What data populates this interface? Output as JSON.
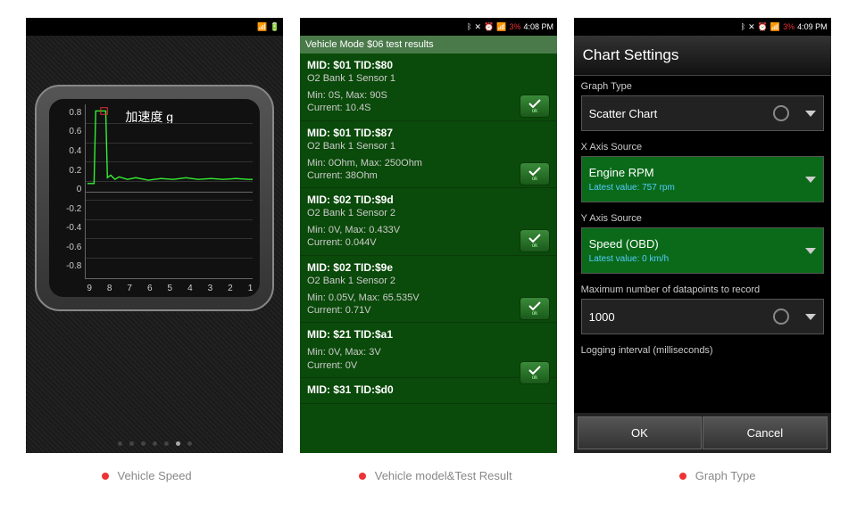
{
  "phone1": {
    "status_time": "",
    "chart_title": "加速度 g",
    "y_ticks": [
      "0.8",
      "0.6",
      "0.4",
      "0.2",
      "0",
      "-0.2",
      "-0.4",
      "-0.6",
      "-0.8"
    ],
    "x_ticks": [
      "9",
      "8",
      "7",
      "6",
      "5",
      "4",
      "3",
      "2",
      "1"
    ],
    "caption": "Vehicle Speed"
  },
  "phone2": {
    "status_time": "4:08 PM",
    "battery": "3%",
    "title": "Vehicle Mode $06 test results",
    "items": [
      {
        "mid": "MID: $01 TID:$80",
        "sensor": "O2 Bank 1 Sensor 1",
        "min": "Min: 0S, Max: 90S",
        "cur": "Current: 10.4S"
      },
      {
        "mid": "MID: $01 TID:$87",
        "sensor": "O2 Bank 1 Sensor 1",
        "min": "Min: 0Ohm, Max: 250Ohm",
        "cur": "Current: 38Ohm"
      },
      {
        "mid": "MID: $02 TID:$9d",
        "sensor": "O2 Bank 1 Sensor 2",
        "min": "Min: 0V, Max: 0.433V",
        "cur": "Current: 0.044V"
      },
      {
        "mid": "MID: $02 TID:$9e",
        "sensor": "O2 Bank 1 Sensor 2",
        "min": "Min: 0.05V, Max: 65.535V",
        "cur": "Current: 0.71V"
      },
      {
        "mid": "MID: $21 TID:$a1",
        "sensor": "",
        "min": "Min: 0V, Max: 3V",
        "cur": "Current: 0V"
      },
      {
        "mid": "MID: $31 TID:$d0",
        "sensor": "",
        "min": "",
        "cur": ""
      }
    ],
    "ok_label": "ok",
    "caption": "Vehicle model&Test Result"
  },
  "phone3": {
    "status_time": "4:09 PM",
    "battery": "3%",
    "header": "Chart Settings",
    "graph_type_label": "Graph Type",
    "graph_type_value": "Scatter Chart",
    "x_axis_label": "X Axis Source",
    "x_axis_value": "Engine RPM",
    "x_axis_sub": "Latest value: 757 rpm",
    "y_axis_label": "Y Axis Source",
    "y_axis_value": "Speed (OBD)",
    "y_axis_sub": "Latest value: 0 km/h",
    "max_label": "Maximum number of datapoints to record",
    "max_value": "1000",
    "interval_label": "Logging interval (milliseconds)",
    "ok": "OK",
    "cancel": "Cancel",
    "caption": "Graph Type"
  },
  "chart_data": {
    "type": "line",
    "title": "加速度 g",
    "xlabel": "",
    "ylabel": "",
    "ylim": [
      -0.9,
      0.9
    ],
    "x": [
      9.5,
      9.3,
      9.1,
      9.0,
      8.9,
      8.8,
      8.6,
      8.4,
      8.2,
      8.0,
      7.5,
      7.0,
      6.5,
      6.0,
      5.5,
      5.0,
      4.5,
      4.0,
      3.5,
      3.0,
      2.5,
      2.0,
      1.5,
      1.0,
      0.8
    ],
    "values": [
      0.0,
      0.0,
      0.85,
      0.85,
      0.85,
      0.85,
      0.05,
      0.08,
      0.02,
      0.05,
      0.03,
      0.06,
      0.02,
      0.04,
      0.03,
      0.05,
      0.02,
      0.04,
      0.03,
      0.05,
      0.02,
      0.04,
      0.03,
      0.04,
      0.03
    ]
  }
}
